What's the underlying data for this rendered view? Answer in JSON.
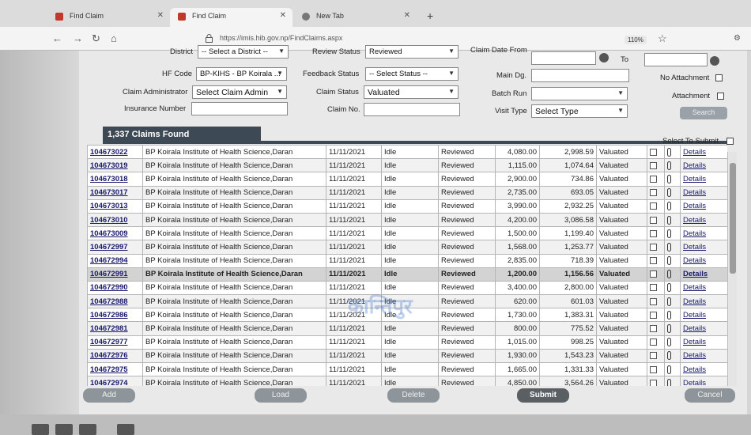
{
  "browser": {
    "tabs": [
      {
        "label": "Find Claim"
      },
      {
        "label": "Find Claim"
      },
      {
        "label": "New Tab"
      }
    ],
    "url": "https://imis.hib.gov.np/FindClaims.aspx",
    "zoom": "110%"
  },
  "filters": {
    "district_label": "District",
    "district_value": "-- Select a District --",
    "review_status_label": "Review Status",
    "review_status_value": "Reviewed",
    "claim_date_from_label": "Claim Date From",
    "to_label": "To",
    "hf_code_label": "HF Code",
    "hf_code_value": "BP-KIHS - BP Koirala ...",
    "feedback_status_label": "Feedback Status",
    "feedback_status_value": "-- Select Status --",
    "main_dg_label": "Main Dg.",
    "no_attachment_label": "No Attachment",
    "claim_admin_label": "Claim Administrator",
    "claim_admin_value": "Select Claim Admin",
    "claim_status_label": "Claim Status",
    "claim_status_value": "Valuated",
    "batch_run_label": "Batch Run",
    "attachment_label": "Attachment",
    "insurance_number_label": "Insurance Number",
    "claim_no_label": "Claim No.",
    "visit_type_label": "Visit Type",
    "visit_type_value": "Select Type",
    "search_label": "Search"
  },
  "results": {
    "count_label": "1,337 Claims Found",
    "select_to_submit_label": "Select To Submit",
    "detail_label": "Details",
    "rows": [
      {
        "id": "104673022",
        "hf": "BP Koirala Institute of Health Science,Daran",
        "date": "11/11/2021",
        "state": "Idle",
        "review": "Reviewed",
        "claimed": "4,080.00",
        "approved": "2,998.59",
        "status": "Valuated"
      },
      {
        "id": "104673019",
        "hf": "BP Koirala Institute of Health Science,Daran",
        "date": "11/11/2021",
        "state": "Idle",
        "review": "Reviewed",
        "claimed": "1,115.00",
        "approved": "1,074.64",
        "status": "Valuated"
      },
      {
        "id": "104673018",
        "hf": "BP Koirala Institute of Health Science,Daran",
        "date": "11/11/2021",
        "state": "Idle",
        "review": "Reviewed",
        "claimed": "2,900.00",
        "approved": "734.86",
        "status": "Valuated"
      },
      {
        "id": "104673017",
        "hf": "BP Koirala Institute of Health Science,Daran",
        "date": "11/11/2021",
        "state": "Idle",
        "review": "Reviewed",
        "claimed": "2,735.00",
        "approved": "693.05",
        "status": "Valuated"
      },
      {
        "id": "104673013",
        "hf": "BP Koirala Institute of Health Science,Daran",
        "date": "11/11/2021",
        "state": "Idle",
        "review": "Reviewed",
        "claimed": "3,990.00",
        "approved": "2,932.25",
        "status": "Valuated"
      },
      {
        "id": "104673010",
        "hf": "BP Koirala Institute of Health Science,Daran",
        "date": "11/11/2021",
        "state": "Idle",
        "review": "Reviewed",
        "claimed": "4,200.00",
        "approved": "3,086.58",
        "status": "Valuated"
      },
      {
        "id": "104673009",
        "hf": "BP Koirala Institute of Health Science,Daran",
        "date": "11/11/2021",
        "state": "Idle",
        "review": "Reviewed",
        "claimed": "1,500.00",
        "approved": "1,199.40",
        "status": "Valuated"
      },
      {
        "id": "104672997",
        "hf": "BP Koirala Institute of Health Science,Daran",
        "date": "11/11/2021",
        "state": "Idle",
        "review": "Reviewed",
        "claimed": "1,568.00",
        "approved": "1,253.77",
        "status": "Valuated"
      },
      {
        "id": "104672994",
        "hf": "BP Koirala Institute of Health Science,Daran",
        "date": "11/11/2021",
        "state": "Idle",
        "review": "Reviewed",
        "claimed": "2,835.00",
        "approved": "718.39",
        "status": "Valuated"
      },
      {
        "id": "104672991",
        "hf": "BP Koirala Institute of Health Science,Daran",
        "date": "11/11/2021",
        "state": "Idle",
        "review": "Reviewed",
        "claimed": "1,200.00",
        "approved": "1,156.56",
        "status": "Valuated",
        "selected": true
      },
      {
        "id": "104672990",
        "hf": "BP Koirala Institute of Health Science,Daran",
        "date": "11/11/2021",
        "state": "Idle",
        "review": "Reviewed",
        "claimed": "3,400.00",
        "approved": "2,800.00",
        "status": "Valuated"
      },
      {
        "id": "104672988",
        "hf": "BP Koirala Institute of Health Science,Daran",
        "date": "11/11/2021",
        "state": "Idle",
        "review": "Reviewed",
        "claimed": "620.00",
        "approved": "601.03",
        "status": "Valuated"
      },
      {
        "id": "104672986",
        "hf": "BP Koirala Institute of Health Science,Daran",
        "date": "11/11/2021",
        "state": "Idle",
        "review": "Reviewed",
        "claimed": "1,730.00",
        "approved": "1,383.31",
        "status": "Valuated"
      },
      {
        "id": "104672981",
        "hf": "BP Koirala Institute of Health Science,Daran",
        "date": "11/11/2021",
        "state": "Idle",
        "review": "Reviewed",
        "claimed": "800.00",
        "approved": "775.52",
        "status": "Valuated"
      },
      {
        "id": "104672977",
        "hf": "BP Koirala Institute of Health Science,Daran",
        "date": "11/11/2021",
        "state": "Idle",
        "review": "Reviewed",
        "claimed": "1,015.00",
        "approved": "998.25",
        "status": "Valuated"
      },
      {
        "id": "104672976",
        "hf": "BP Koirala Institute of Health Science,Daran",
        "date": "11/11/2021",
        "state": "Idle",
        "review": "Reviewed",
        "claimed": "1,930.00",
        "approved": "1,543.23",
        "status": "Valuated"
      },
      {
        "id": "104672975",
        "hf": "BP Koirala Institute of Health Science,Daran",
        "date": "11/11/2021",
        "state": "Idle",
        "review": "Reviewed",
        "claimed": "1,665.00",
        "approved": "1,331.33",
        "status": "Valuated"
      },
      {
        "id": "104672974",
        "hf": "BP Koirala Institute of Health Science,Daran",
        "date": "11/11/2021",
        "state": "Idle",
        "review": "Reviewed",
        "claimed": "4,850.00",
        "approved": "3,564.26",
        "status": "Valuated"
      }
    ]
  },
  "actions": {
    "add": "Add",
    "load": "Load",
    "delete": "Delete",
    "submit": "Submit",
    "cancel": "Cancel"
  },
  "watermark": "कान्तिपुर"
}
